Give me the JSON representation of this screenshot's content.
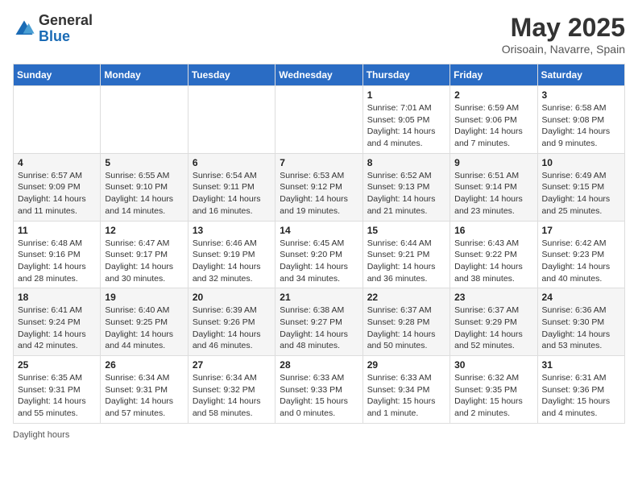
{
  "header": {
    "logo_general": "General",
    "logo_blue": "Blue",
    "month_title": "May 2025",
    "location": "Orisoain, Navarre, Spain"
  },
  "days_of_week": [
    "Sunday",
    "Monday",
    "Tuesday",
    "Wednesday",
    "Thursday",
    "Friday",
    "Saturday"
  ],
  "weeks": [
    [
      {
        "day": "",
        "info": ""
      },
      {
        "day": "",
        "info": ""
      },
      {
        "day": "",
        "info": ""
      },
      {
        "day": "",
        "info": ""
      },
      {
        "day": "1",
        "info": "Sunrise: 7:01 AM\nSunset: 9:05 PM\nDaylight: 14 hours\nand 4 minutes."
      },
      {
        "day": "2",
        "info": "Sunrise: 6:59 AM\nSunset: 9:06 PM\nDaylight: 14 hours\nand 7 minutes."
      },
      {
        "day": "3",
        "info": "Sunrise: 6:58 AM\nSunset: 9:08 PM\nDaylight: 14 hours\nand 9 minutes."
      }
    ],
    [
      {
        "day": "4",
        "info": "Sunrise: 6:57 AM\nSunset: 9:09 PM\nDaylight: 14 hours\nand 11 minutes."
      },
      {
        "day": "5",
        "info": "Sunrise: 6:55 AM\nSunset: 9:10 PM\nDaylight: 14 hours\nand 14 minutes."
      },
      {
        "day": "6",
        "info": "Sunrise: 6:54 AM\nSunset: 9:11 PM\nDaylight: 14 hours\nand 16 minutes."
      },
      {
        "day": "7",
        "info": "Sunrise: 6:53 AM\nSunset: 9:12 PM\nDaylight: 14 hours\nand 19 minutes."
      },
      {
        "day": "8",
        "info": "Sunrise: 6:52 AM\nSunset: 9:13 PM\nDaylight: 14 hours\nand 21 minutes."
      },
      {
        "day": "9",
        "info": "Sunrise: 6:51 AM\nSunset: 9:14 PM\nDaylight: 14 hours\nand 23 minutes."
      },
      {
        "day": "10",
        "info": "Sunrise: 6:49 AM\nSunset: 9:15 PM\nDaylight: 14 hours\nand 25 minutes."
      }
    ],
    [
      {
        "day": "11",
        "info": "Sunrise: 6:48 AM\nSunset: 9:16 PM\nDaylight: 14 hours\nand 28 minutes."
      },
      {
        "day": "12",
        "info": "Sunrise: 6:47 AM\nSunset: 9:17 PM\nDaylight: 14 hours\nand 30 minutes."
      },
      {
        "day": "13",
        "info": "Sunrise: 6:46 AM\nSunset: 9:19 PM\nDaylight: 14 hours\nand 32 minutes."
      },
      {
        "day": "14",
        "info": "Sunrise: 6:45 AM\nSunset: 9:20 PM\nDaylight: 14 hours\nand 34 minutes."
      },
      {
        "day": "15",
        "info": "Sunrise: 6:44 AM\nSunset: 9:21 PM\nDaylight: 14 hours\nand 36 minutes."
      },
      {
        "day": "16",
        "info": "Sunrise: 6:43 AM\nSunset: 9:22 PM\nDaylight: 14 hours\nand 38 minutes."
      },
      {
        "day": "17",
        "info": "Sunrise: 6:42 AM\nSunset: 9:23 PM\nDaylight: 14 hours\nand 40 minutes."
      }
    ],
    [
      {
        "day": "18",
        "info": "Sunrise: 6:41 AM\nSunset: 9:24 PM\nDaylight: 14 hours\nand 42 minutes."
      },
      {
        "day": "19",
        "info": "Sunrise: 6:40 AM\nSunset: 9:25 PM\nDaylight: 14 hours\nand 44 minutes."
      },
      {
        "day": "20",
        "info": "Sunrise: 6:39 AM\nSunset: 9:26 PM\nDaylight: 14 hours\nand 46 minutes."
      },
      {
        "day": "21",
        "info": "Sunrise: 6:38 AM\nSunset: 9:27 PM\nDaylight: 14 hours\nand 48 minutes."
      },
      {
        "day": "22",
        "info": "Sunrise: 6:37 AM\nSunset: 9:28 PM\nDaylight: 14 hours\nand 50 minutes."
      },
      {
        "day": "23",
        "info": "Sunrise: 6:37 AM\nSunset: 9:29 PM\nDaylight: 14 hours\nand 52 minutes."
      },
      {
        "day": "24",
        "info": "Sunrise: 6:36 AM\nSunset: 9:30 PM\nDaylight: 14 hours\nand 53 minutes."
      }
    ],
    [
      {
        "day": "25",
        "info": "Sunrise: 6:35 AM\nSunset: 9:31 PM\nDaylight: 14 hours\nand 55 minutes."
      },
      {
        "day": "26",
        "info": "Sunrise: 6:34 AM\nSunset: 9:31 PM\nDaylight: 14 hours\nand 57 minutes."
      },
      {
        "day": "27",
        "info": "Sunrise: 6:34 AM\nSunset: 9:32 PM\nDaylight: 14 hours\nand 58 minutes."
      },
      {
        "day": "28",
        "info": "Sunrise: 6:33 AM\nSunset: 9:33 PM\nDaylight: 15 hours\nand 0 minutes."
      },
      {
        "day": "29",
        "info": "Sunrise: 6:33 AM\nSunset: 9:34 PM\nDaylight: 15 hours\nand 1 minute."
      },
      {
        "day": "30",
        "info": "Sunrise: 6:32 AM\nSunset: 9:35 PM\nDaylight: 15 hours\nand 2 minutes."
      },
      {
        "day": "31",
        "info": "Sunrise: 6:31 AM\nSunset: 9:36 PM\nDaylight: 15 hours\nand 4 minutes."
      }
    ]
  ],
  "footer": {
    "note": "Daylight hours"
  }
}
